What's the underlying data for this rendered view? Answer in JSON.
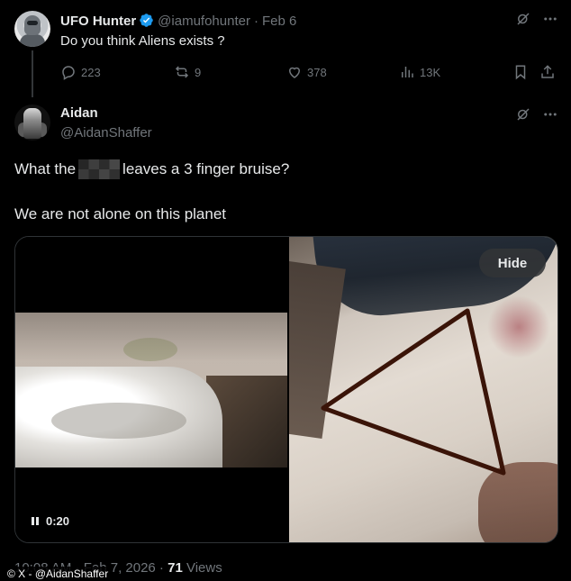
{
  "parent_tweet": {
    "author_name": "UFO Hunter",
    "handle": "@iamufohunter",
    "separator": "·",
    "date": "Feb 6",
    "text": "Do you think Aliens exists ?",
    "replies": "223",
    "reposts": "9",
    "likes": "378",
    "views": "13K",
    "icons": [
      "verified-badge-icon",
      "grok-icon",
      "more-icon",
      "reply-icon",
      "repost-icon",
      "like-icon",
      "views-icon",
      "bookmark-icon",
      "share-icon"
    ]
  },
  "reply_tweet": {
    "author_name": "Aidan",
    "handle": "@AidanShaffer",
    "line1_before": "What the",
    "line1_after": "leaves a 3 finger bruise?",
    "line2": "We are not alone on this planet",
    "video_time": "0:20",
    "hide_label": "Hide",
    "timestamp": "10:08 AM · Feb 7, 2026 ·",
    "views_count": "71",
    "views_label": "Views",
    "icons": [
      "grok-icon",
      "more-icon",
      "pause-icon"
    ]
  },
  "watermark": {
    "credit": "© X - @AidanShaffer"
  },
  "colors": {
    "background": "#000000",
    "primary_text": "#e7e9ea",
    "secondary_text": "#71767b",
    "verified_blue": "#1d9bf0",
    "border": "#2f3336",
    "drawn_triangle": "#3a1408"
  }
}
